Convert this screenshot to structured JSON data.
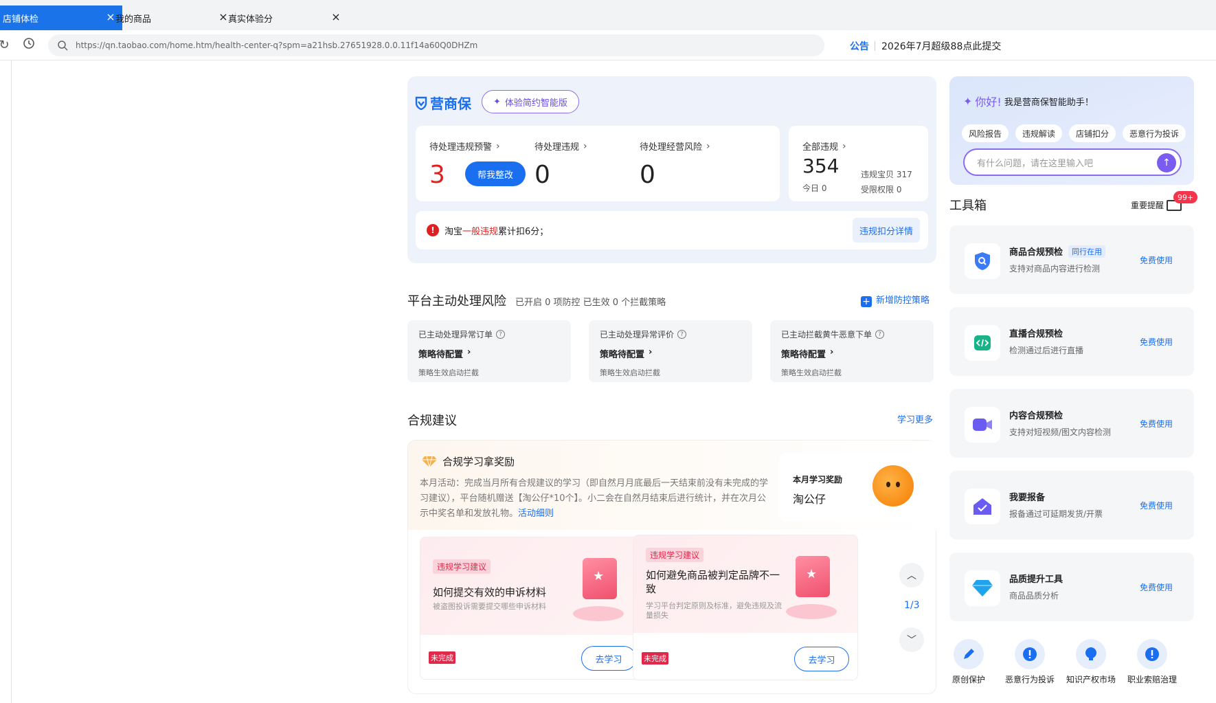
{
  "browser": {
    "tabs": [
      {
        "label": "店铺体检",
        "close": "×"
      },
      {
        "label": "我的商品",
        "close": "×"
      },
      {
        "label": "真实体验分",
        "close": "×"
      }
    ],
    "url": "https://qn.taobao.com/home.htm/health-center-q?spm=a21hsb.27651928.0.0.11f14a60Q0DHZm",
    "notice_label": "公告",
    "notice_text": "2026年7月超级88点此提交"
  },
  "overview": {
    "brand": "营商保",
    "smart_button": "体验简约智能版",
    "pending_warning": {
      "title": "待处理违规预警",
      "value": "3",
      "button": "帮我整改"
    },
    "pending_violation": {
      "title": "待处理违规",
      "value": "0"
    },
    "pending_risk": {
      "title": "待处理经营风险",
      "value": "0"
    },
    "all_violation": {
      "title": "全部违规",
      "value": "354",
      "today": "今日 0",
      "goods": "违规宝贝 317",
      "limited": "受限权限 0"
    },
    "tip": {
      "prefix": "淘宝 ",
      "highlight": "一般违规",
      "suffix": "累计扣6分；",
      "link": "违规扣分详情"
    }
  },
  "platform_risk": {
    "title": "平台主动处理风险",
    "summary": "已开启 0 项防控 已生效 0 个拦截策略",
    "add_link": "新增防控策略",
    "cards": [
      {
        "title": "已主动处理异常订单",
        "status": "策略待配置",
        "note": "策略生效启动拦截"
      },
      {
        "title": "已主动处理异常评价",
        "status": "策略待配置",
        "note": "策略生效启动拦截"
      },
      {
        "title": "已主动拦截黄牛恶意下单",
        "status": "策略待配置",
        "note": "策略生效启动拦截"
      }
    ]
  },
  "compliance": {
    "title": "合规建议",
    "more": "学习更多",
    "reward_title": "合规学习拿奖励",
    "desc": "本月活动：完成当月所有合规建议的学习（即自然月月底最后一天结束前没有未完成的学习建议），平台随机赠送【淘公仔*10个】。小二会在自然月结束后进行统计，并在次月公示中奖名单和发放礼物。",
    "desc_link": "活动细则",
    "month_reward_label": "本月学习奖励",
    "month_reward_value": "淘公仔",
    "courses": [
      {
        "tag": "违规学习建议",
        "title": "如何提交有效的申诉材料",
        "subtitle": "被盗图投诉需要提交哪些申诉材料",
        "status": "未完成",
        "button": "去学习"
      },
      {
        "tag": "违规学习建议",
        "title": "如何避免商品被判定品牌不一致",
        "subtitle": "学习平台判定原则及标准，避免违规及流量损失",
        "status": "未完成",
        "button": "去学习"
      }
    ],
    "page": "1/3"
  },
  "assistant": {
    "greeting": "你好!",
    "intro": "我是营商保智能助手！",
    "chips": [
      "风险报告",
      "违规解读",
      "店铺扣分",
      "恶意行为投诉"
    ],
    "placeholder": "有什么问题，请在这里输入吧"
  },
  "toolbox": {
    "title": "工具箱",
    "remind": "重要提醒",
    "badge": "99+",
    "tools": [
      {
        "name": "商品合规预检",
        "tag": "同行在用",
        "desc": "支持对商品内容进行检测",
        "action": "免费使用",
        "icon": "shield-search-icon"
      },
      {
        "name": "直播合规预检",
        "tag": "",
        "desc": "检测通过后进行直播",
        "action": "免费使用",
        "icon": "code-icon"
      },
      {
        "name": "内容合规预检",
        "tag": "",
        "desc": "支持对短视频/图文内容检测",
        "action": "免费使用",
        "icon": "video-icon"
      },
      {
        "name": "我要报备",
        "tag": "",
        "desc": "报备通过可延期发货/开票",
        "action": "免费使用",
        "icon": "check-house-icon"
      },
      {
        "name": "品质提升工具",
        "tag": "",
        "desc": "商品品质分析",
        "action": "免费使用",
        "icon": "diamond-icon"
      }
    ],
    "quick": [
      {
        "label": "原创保护",
        "icon": "pen-icon"
      },
      {
        "label": "恶意行为投诉",
        "icon": "alert-icon"
      },
      {
        "label": "知识产权市场",
        "icon": "bulb-icon"
      },
      {
        "label": "职业索赔治理",
        "icon": "alert-icon"
      }
    ]
  },
  "colors": {
    "primary": "#1a6ef0",
    "danger": "#e02020",
    "purple": "#7a5cf0"
  }
}
